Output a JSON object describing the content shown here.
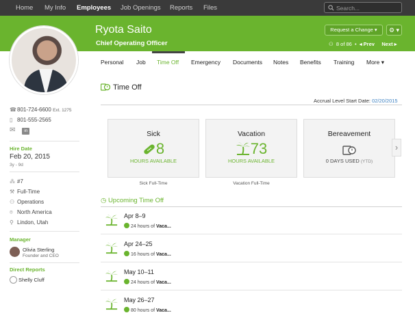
{
  "nav": {
    "items": [
      "Home",
      "My Info",
      "Employees",
      "Job Openings",
      "Reports",
      "Files"
    ],
    "active": "Employees",
    "search_placeholder": "Search..."
  },
  "header": {
    "name": "Ryota Saito",
    "job_title": "Chief Operating Officer",
    "request_button": "Request a Change ▾",
    "gear_button": "⚙ ▾",
    "pager": {
      "position": "8 of 86",
      "prev": "◂ Prev",
      "next": "Next ▸"
    }
  },
  "tabs": {
    "items": [
      "Personal",
      "Job",
      "Time Off",
      "Emergency",
      "Documents",
      "Notes",
      "Benefits",
      "Training",
      "More ▾"
    ],
    "active": "Time Off"
  },
  "sidebar": {
    "phone_work": "801-724-6600",
    "phone_ext": "Ext. 1275",
    "phone_mobile": "801-555-2565",
    "hire_date_label": "Hire Date",
    "hire_date": "Feb 20, 2015",
    "hire_length": "3y - 9d",
    "employee_number": "#7",
    "employment_type": "Full-Time",
    "department": "Operations",
    "division": "North America",
    "location": "Lindon, Utah",
    "manager_label": "Manager",
    "manager_name": "Olivia Sterling",
    "manager_title": "Founder and CEO",
    "direct_reports_label": "Direct Reports",
    "direct_report_name": "Shelly Cluff"
  },
  "time_off": {
    "section_title": "Time Off",
    "accrual_label": "Accrual Level Start Date:",
    "accrual_date": "02/20/2015",
    "cards": [
      {
        "name": "Sick",
        "value": "8",
        "subtitle": "HOURS AVAILABLE",
        "caption": "Sick Full-Time"
      },
      {
        "name": "Vacation",
        "value": "73",
        "subtitle": "HOURS AVAILABLE",
        "caption": "Vacation Full-Time"
      },
      {
        "name": "Bereavement",
        "value": "",
        "subtitle": "0 DAYS USED",
        "subtitle_suffix": "(YTD)",
        "caption": ""
      }
    ],
    "upcoming_title": "Upcoming Time Off",
    "upcoming": [
      {
        "date": "Apr 8–9",
        "hours": "24 hours of",
        "type": "Vaca..."
      },
      {
        "date": "Apr 24–25",
        "hours": "16 hours of",
        "type": "Vaca..."
      },
      {
        "date": "May 10–11",
        "hours": "24 hours of",
        "type": "Vaca..."
      },
      {
        "date": "May 26–27",
        "hours": "80 hours of",
        "type": "Vaca..."
      }
    ]
  },
  "colors": {
    "accent": "#6ab42e",
    "nav_bg": "#3a3a3a",
    "link": "#3a7fc1"
  }
}
